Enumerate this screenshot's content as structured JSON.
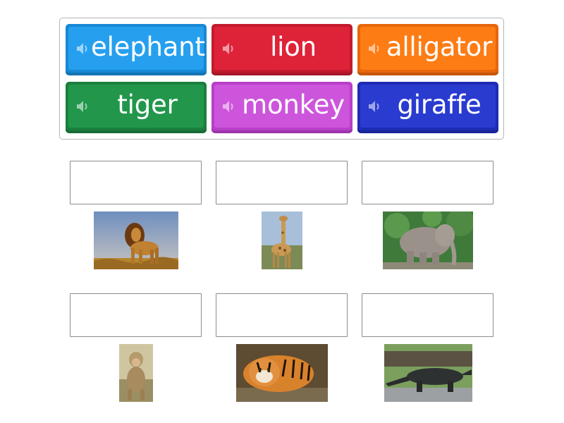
{
  "word_bank": {
    "tiles": [
      {
        "label": "elephant",
        "color": "#1f97e6",
        "icon": "speaker-icon"
      },
      {
        "label": "lion",
        "color": "#d91f36",
        "icon": "speaker-icon"
      },
      {
        "label": "alligator",
        "color": "#fb7410",
        "icon": "speaker-icon"
      },
      {
        "label": "tiger",
        "color": "#1f9148",
        "icon": "speaker-icon"
      },
      {
        "label": "monkey",
        "color": "#c94ed8",
        "icon": "speaker-icon"
      },
      {
        "label": "giraffe",
        "color": "#2535cb",
        "icon": "speaker-icon"
      }
    ]
  },
  "targets": [
    {
      "image": "lion-photo"
    },
    {
      "image": "giraffe-photo"
    },
    {
      "image": "elephant-photo"
    },
    {
      "image": "monkey-photo"
    },
    {
      "image": "tiger-photo"
    },
    {
      "image": "alligator-photo"
    }
  ]
}
